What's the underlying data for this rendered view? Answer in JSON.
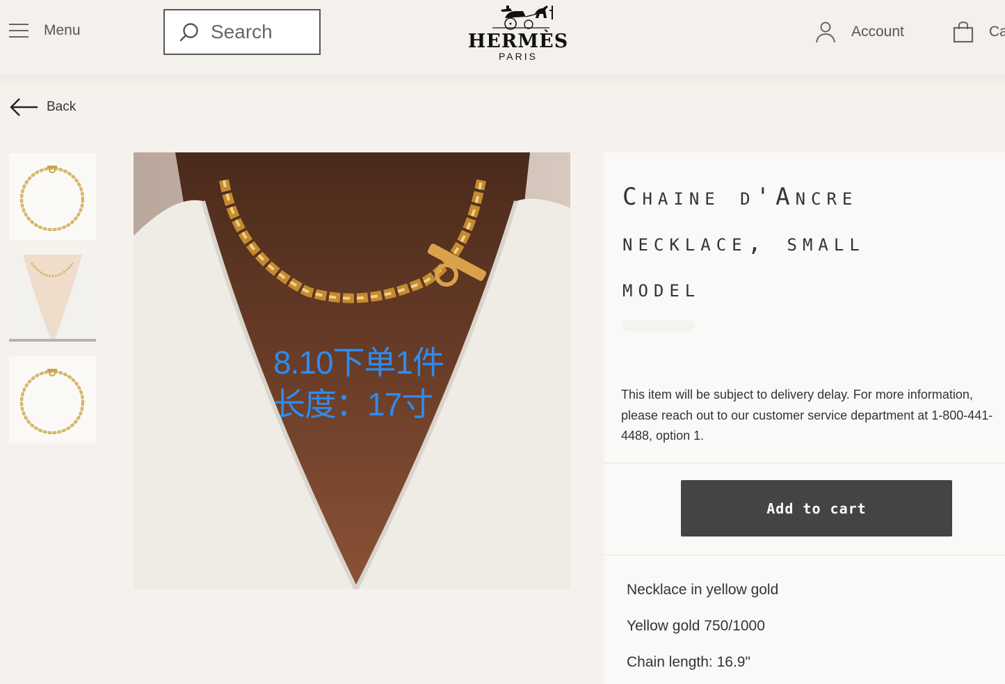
{
  "header": {
    "menu_label": "Menu",
    "search_placeholder": "Search",
    "logo_brand": "HERMÈS",
    "logo_city": "PARIS",
    "account_label": "Account",
    "cart_label": "Ca"
  },
  "nav": {
    "back_label": "Back"
  },
  "gallery": {
    "thumbnails": [
      "necklace-flat",
      "necklace-worn",
      "necklace-flat"
    ],
    "selected_index": 1,
    "overlay_line1": "8.10下单1件",
    "overlay_line2": "长度：17寸"
  },
  "product": {
    "title_line1": "Chaine d'Ancre",
    "title_line2": "necklace, small",
    "title_line3": "model",
    "delivery_notice": "This item will be subject to delivery delay. For more information, please reach out to our customer service department at 1-800-441-4488, option 1.",
    "add_to_cart_label": "Add to cart",
    "details": [
      "Necklace in yellow gold",
      "Yellow gold 750/1000",
      "Chain length: 16.9\""
    ]
  },
  "colors": {
    "page_bg": "#f5f2ed",
    "button_bg": "#444444",
    "overlay_text": "#2e8cf0"
  }
}
